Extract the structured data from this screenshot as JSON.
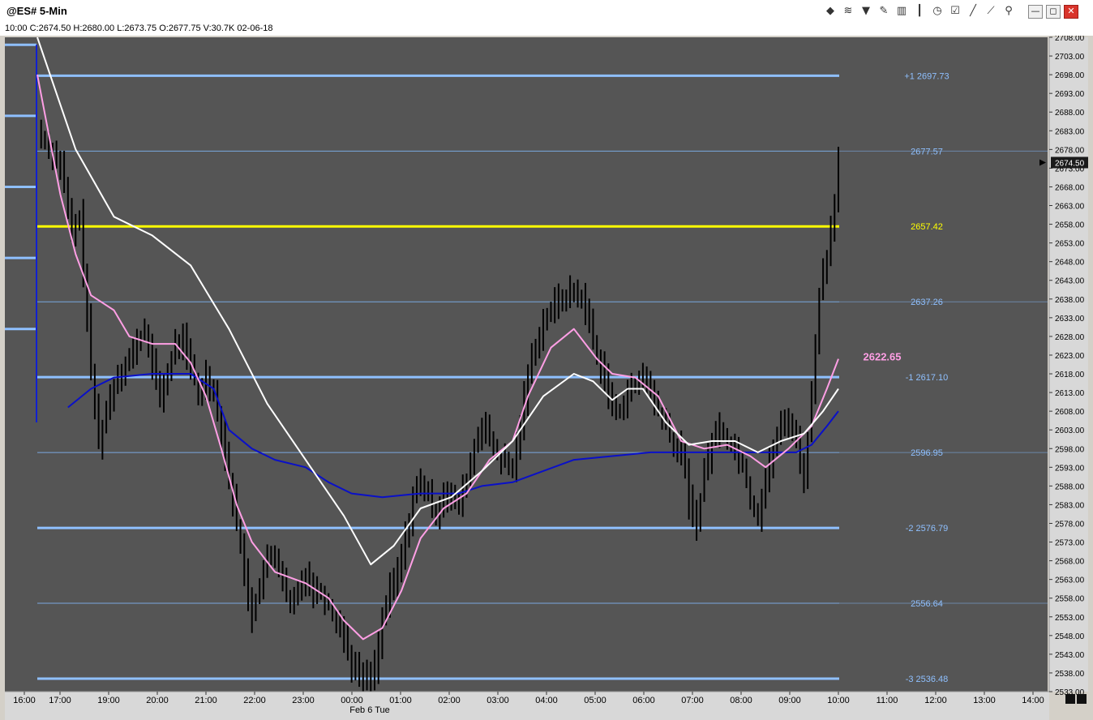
{
  "window": {
    "title": "@ES# 5-Min",
    "info_line": "10:00  C:2674.50  H:2680.00  L:2673.75  O:2677.75  V:30.7K  02-06-18"
  },
  "toolbar": {
    "icons": [
      "data-stack-icon",
      "wave-icon",
      "funnel-icon",
      "pencil-icon",
      "bar-chart-icon",
      "candlestick-icon",
      "clock-icon",
      "checklist-icon",
      "drawing-pen-icon",
      "trendline-icon",
      "magic-wand-icon"
    ],
    "glyphs": [
      "◆",
      "≋",
      "▼",
      "✎",
      "▥",
      "┃",
      "◷",
      "☑",
      "╱",
      "⟋",
      "⚲"
    ]
  },
  "window_buttons": {
    "minimize": "—",
    "restore": "◻",
    "close": "✕"
  },
  "chart_data": {
    "type": "bar",
    "title": "@ES# 5-Min",
    "y_unit": "price",
    "ylim": [
      2533,
      2708
    ],
    "y_ticks": [
      "2708.00",
      "2703.00",
      "2698.00",
      "2693.00",
      "2688.00",
      "2683.00",
      "2678.00",
      "2673.00",
      "2668.00",
      "2663.00",
      "2658.00",
      "2653.00",
      "2648.00",
      "2643.00",
      "2638.00",
      "2633.00",
      "2628.00",
      "2623.00",
      "2618.00",
      "2613.00",
      "2608.00",
      "2603.00",
      "2598.00",
      "2593.00",
      "2588.00",
      "2583.00",
      "2578.00",
      "2573.00",
      "2568.00",
      "2563.00",
      "2558.00",
      "2553.00",
      "2548.00",
      "2543.00",
      "2538.00",
      "2533.00"
    ],
    "x_ticks": [
      "16:00",
      "17:00",
      "19:00",
      "20:00",
      "21:00",
      "22:00",
      "23:00",
      "00:00",
      "01:00",
      "02:00",
      "03:00",
      "04:00",
      "05:00",
      "06:00",
      "07:00",
      "08:00",
      "09:00",
      "10:00",
      "11:00",
      "12:00",
      "13:00",
      "14:00"
    ],
    "x_sublabel": "Feb 6 Tue",
    "last_price": "2674.50",
    "pink_ma_label": "2622.65",
    "levels": [
      {
        "label": "+1 2697.73",
        "price": 2697.73,
        "kind": "band"
      },
      {
        "label": "2677.57",
        "price": 2677.57,
        "kind": "mid"
      },
      {
        "label": "2657.42",
        "price": 2657.42,
        "kind": "pivot"
      },
      {
        "label": "2637.26",
        "price": 2637.26,
        "kind": "mid"
      },
      {
        "label": "-1 2617.10",
        "price": 2617.1,
        "kind": "band"
      },
      {
        "label": "2596.95",
        "price": 2596.95,
        "kind": "mid"
      },
      {
        "label": "-2 2576.79",
        "price": 2576.79,
        "kind": "band"
      },
      {
        "label": "2556.64",
        "price": 2556.64,
        "kind": "mid"
      },
      {
        "label": "-3 2536.48",
        "price": 2536.48,
        "kind": "band"
      }
    ],
    "prev_levels": [
      2706,
      2687,
      2668,
      2649,
      2630
    ],
    "price_path": [
      [
        0,
        2683
      ],
      [
        6,
        2674
      ],
      [
        9,
        2655
      ],
      [
        11,
        2660
      ],
      [
        14,
        2618
      ],
      [
        16,
        2600
      ],
      [
        19,
        2612
      ],
      [
        21,
        2618
      ],
      [
        24,
        2622
      ],
      [
        26,
        2626
      ],
      [
        28,
        2630
      ],
      [
        30,
        2620
      ],
      [
        32,
        2612
      ],
      [
        34,
        2618
      ],
      [
        36,
        2626
      ],
      [
        38,
        2627
      ],
      [
        40,
        2620
      ],
      [
        42,
        2612
      ],
      [
        44,
        2618
      ],
      [
        46,
        2613
      ],
      [
        48,
        2603
      ],
      [
        50,
        2590
      ],
      [
        52,
        2578
      ],
      [
        54,
        2565
      ],
      [
        56,
        2553
      ],
      [
        58,
        2562
      ],
      [
        60,
        2568
      ],
      [
        62,
        2570
      ],
      [
        64,
        2562
      ],
      [
        66,
        2555
      ],
      [
        68,
        2560
      ],
      [
        70,
        2565
      ],
      [
        72,
        2560
      ],
      [
        74,
        2560
      ],
      [
        76,
        2556
      ],
      [
        78,
        2552
      ],
      [
        80,
        2548
      ],
      [
        82,
        2540
      ],
      [
        84,
        2538
      ],
      [
        86,
        2536
      ],
      [
        88,
        2540
      ],
      [
        90,
        2552
      ],
      [
        92,
        2560
      ],
      [
        94,
        2565
      ],
      [
        96,
        2574
      ],
      [
        98,
        2585
      ],
      [
        100,
        2589
      ],
      [
        102,
        2585
      ],
      [
        104,
        2580
      ],
      [
        106,
        2587
      ],
      [
        108,
        2584
      ],
      [
        110,
        2583
      ],
      [
        112,
        2590
      ],
      [
        114,
        2598
      ],
      [
        116,
        2605
      ],
      [
        118,
        2600
      ],
      [
        120,
        2596
      ],
      [
        122,
        2594
      ],
      [
        124,
        2592
      ],
      [
        126,
        2605
      ],
      [
        128,
        2618
      ],
      [
        130,
        2626
      ],
      [
        132,
        2632
      ],
      [
        134,
        2635
      ],
      [
        136,
        2638
      ],
      [
        138,
        2639
      ],
      [
        140,
        2640
      ],
      [
        142,
        2638
      ],
      [
        144,
        2632
      ],
      [
        146,
        2622
      ],
      [
        148,
        2618
      ],
      [
        150,
        2608
      ],
      [
        152,
        2608
      ],
      [
        154,
        2614
      ],
      [
        156,
        2614
      ],
      [
        158,
        2618
      ],
      [
        160,
        2613
      ],
      [
        162,
        2608
      ],
      [
        164,
        2604
      ],
      [
        166,
        2598
      ],
      [
        168,
        2598
      ],
      [
        170,
        2584
      ],
      [
        172,
        2578
      ],
      [
        174,
        2592
      ],
      [
        176,
        2600
      ],
      [
        178,
        2604
      ],
      [
        180,
        2600
      ],
      [
        182,
        2598
      ],
      [
        184,
        2594
      ],
      [
        186,
        2584
      ],
      [
        188,
        2580
      ],
      [
        190,
        2590
      ],
      [
        192,
        2598
      ],
      [
        194,
        2604
      ],
      [
        196,
        2606
      ],
      [
        198,
        2600
      ],
      [
        200,
        2590
      ],
      [
        202,
        2612
      ],
      [
        204,
        2640
      ],
      [
        206,
        2650
      ],
      [
        208,
        2665
      ],
      [
        209,
        2676
      ]
    ],
    "ma_white": [
      [
        0,
        2708
      ],
      [
        10,
        2678
      ],
      [
        20,
        2660
      ],
      [
        30,
        2655
      ],
      [
        40,
        2647
      ],
      [
        50,
        2630
      ],
      [
        60,
        2610
      ],
      [
        70,
        2595
      ],
      [
        80,
        2580
      ],
      [
        87,
        2567
      ],
      [
        93,
        2572
      ],
      [
        100,
        2582
      ],
      [
        108,
        2585
      ],
      [
        116,
        2592
      ],
      [
        124,
        2600
      ],
      [
        132,
        2612
      ],
      [
        140,
        2618
      ],
      [
        145,
        2616
      ],
      [
        150,
        2611
      ],
      [
        154,
        2614
      ],
      [
        158,
        2614
      ],
      [
        164,
        2605
      ],
      [
        170,
        2599
      ],
      [
        176,
        2600
      ],
      [
        182,
        2600
      ],
      [
        188,
        2597
      ],
      [
        194,
        2600
      ],
      [
        200,
        2602
      ],
      [
        205,
        2608
      ],
      [
        209,
        2614
      ]
    ],
    "ma_pink": [
      [
        0,
        2698
      ],
      [
        6,
        2666
      ],
      [
        10,
        2650
      ],
      [
        14,
        2639
      ],
      [
        20,
        2635
      ],
      [
        24,
        2628
      ],
      [
        30,
        2626
      ],
      [
        36,
        2626
      ],
      [
        40,
        2621
      ],
      [
        44,
        2612
      ],
      [
        48,
        2598
      ],
      [
        52,
        2583
      ],
      [
        56,
        2573
      ],
      [
        62,
        2565
      ],
      [
        70,
        2562
      ],
      [
        76,
        2558
      ],
      [
        80,
        2552
      ],
      [
        85,
        2547
      ],
      [
        90,
        2550
      ],
      [
        95,
        2560
      ],
      [
        100,
        2574
      ],
      [
        106,
        2582
      ],
      [
        112,
        2586
      ],
      [
        118,
        2595
      ],
      [
        124,
        2600
      ],
      [
        128,
        2612
      ],
      [
        134,
        2625
      ],
      [
        140,
        2630
      ],
      [
        146,
        2622
      ],
      [
        150,
        2618
      ],
      [
        156,
        2617
      ],
      [
        162,
        2612
      ],
      [
        168,
        2600
      ],
      [
        174,
        2598
      ],
      [
        180,
        2599
      ],
      [
        186,
        2596
      ],
      [
        190,
        2593
      ],
      [
        196,
        2598
      ],
      [
        202,
        2604
      ],
      [
        206,
        2614
      ],
      [
        209,
        2622
      ]
    ],
    "ma_blue": [
      [
        8,
        2609
      ],
      [
        14,
        2614
      ],
      [
        20,
        2617
      ],
      [
        30,
        2618
      ],
      [
        40,
        2618
      ],
      [
        46,
        2614
      ],
      [
        50,
        2603
      ],
      [
        56,
        2598
      ],
      [
        62,
        2595
      ],
      [
        70,
        2593
      ],
      [
        76,
        2589
      ],
      [
        82,
        2586
      ],
      [
        90,
        2585
      ],
      [
        100,
        2586
      ],
      [
        110,
        2586
      ],
      [
        116,
        2588
      ],
      [
        124,
        2589
      ],
      [
        132,
        2592
      ],
      [
        140,
        2595
      ],
      [
        150,
        2596
      ],
      [
        160,
        2597
      ],
      [
        168,
        2597
      ],
      [
        176,
        2597
      ],
      [
        184,
        2597
      ],
      [
        192,
        2597
      ],
      [
        198,
        2597
      ],
      [
        202,
        2599
      ],
      [
        206,
        2604
      ],
      [
        209,
        2608
      ]
    ],
    "bar_count": 210,
    "colors": {
      "background": "#555555",
      "bars": "#000000",
      "band_lines": "#8fc0ff",
      "mid_lines": "#7aa8e0",
      "pivot_line": "#ffff00",
      "ma_white": "#ffffff",
      "ma_pink": "#ff9fe5",
      "ma_blue": "#0a10c8",
      "axis_bg": "#d8d8d8"
    }
  }
}
